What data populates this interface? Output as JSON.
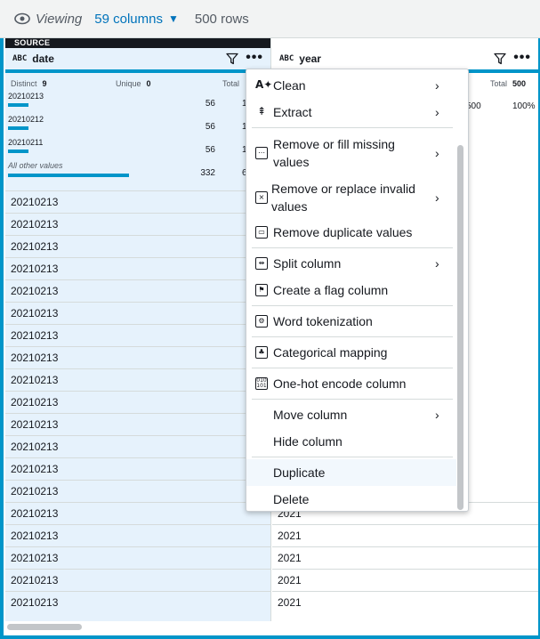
{
  "topbar": {
    "viewing_label": "Viewing",
    "columns_label": "59 columns",
    "rows_label": "500 rows"
  },
  "date_column": {
    "source_tag": "SOURCE",
    "type_badge": "ABC",
    "name": "date",
    "distinct_label": "Distinct",
    "distinct_value": "9",
    "unique_label": "Unique",
    "unique_value": "0",
    "total_label": "Total",
    "top_values": [
      {
        "value": "20210213",
        "count": "56",
        "pct": "1",
        "bar_fraction": 0.17
      },
      {
        "value": "20210212",
        "count": "56",
        "pct": "1",
        "bar_fraction": 0.17
      },
      {
        "value": "20210211",
        "count": "56",
        "pct": "1",
        "bar_fraction": 0.17
      },
      {
        "value": "All other values",
        "count": "332",
        "pct": "6",
        "bar_fraction": 1.0
      }
    ],
    "rows": [
      "20210213",
      "20210213",
      "20210213",
      "20210213",
      "20210213",
      "20210213",
      "20210213",
      "20210213",
      "20210213",
      "20210213",
      "20210213",
      "20210213",
      "20210213",
      "20210213",
      "20210213",
      "20210213",
      "20210213",
      "20210213",
      "20210213"
    ]
  },
  "year_column": {
    "type_badge": "ABC",
    "name": "year",
    "total_label": "Total",
    "total_value": "500",
    "top_count": "500",
    "top_pct": "100%",
    "rows": [
      "2021",
      "2021",
      "2021",
      "2021",
      "2021"
    ]
  },
  "menu": {
    "items": [
      {
        "label": "Clean",
        "icon": "clean-icon",
        "submenu": true
      },
      {
        "label": "Extract",
        "icon": "extract-icon",
        "submenu": true
      },
      {
        "label": "Remove or fill missing values",
        "icon": "missing-values-icon",
        "submenu": true
      },
      {
        "label": "Remove or replace invalid values",
        "icon": "invalid-values-icon",
        "submenu": true
      },
      {
        "label": "Remove duplicate values",
        "icon": "duplicate-values-icon",
        "submenu": false
      },
      {
        "label": "Split column",
        "icon": "split-column-icon",
        "submenu": true
      },
      {
        "label": "Create a flag column",
        "icon": "flag-column-icon",
        "submenu": false
      },
      {
        "label": "Word tokenization",
        "icon": "tokenization-icon",
        "submenu": false
      },
      {
        "label": "Categorical mapping",
        "icon": "categorical-mapping-icon",
        "submenu": false
      },
      {
        "label": "One-hot encode column",
        "icon": "one-hot-icon",
        "submenu": false
      },
      {
        "label": "Move column",
        "icon": "",
        "submenu": true
      },
      {
        "label": "Hide column",
        "icon": "",
        "submenu": false
      },
      {
        "label": "Duplicate",
        "icon": "",
        "submenu": false
      },
      {
        "label": "Delete",
        "icon": "",
        "submenu": false
      }
    ]
  },
  "colors": {
    "accent": "#0095c9",
    "link": "#0073bb",
    "selected_column_bg": "#e6f2fc"
  }
}
